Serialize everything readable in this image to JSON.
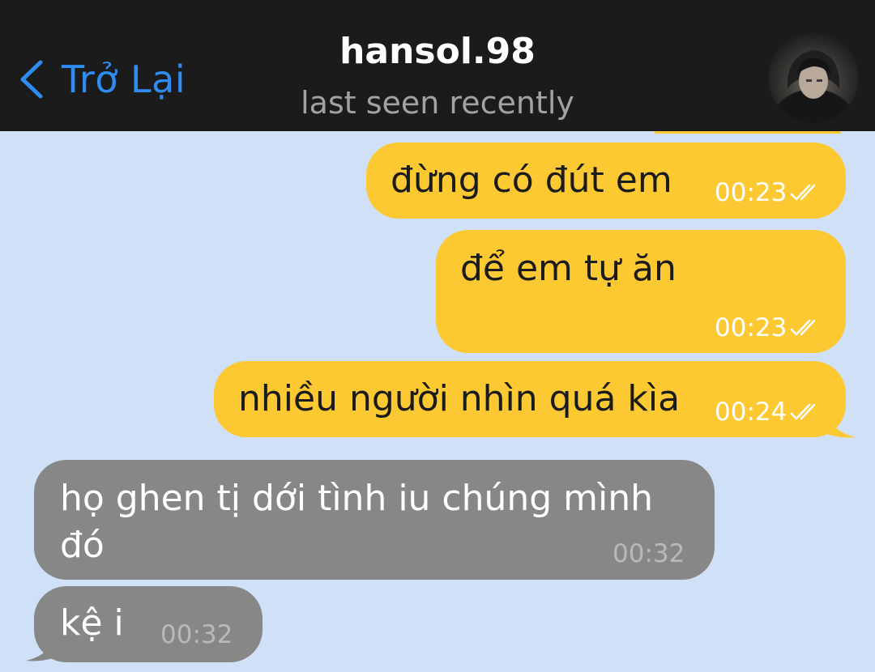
{
  "header": {
    "back_label": "Trở Lại",
    "title": "hansol.98",
    "status": "last seen recently"
  },
  "colors": {
    "header_bg": "#1b1b1b",
    "accent": "#2f8cf0",
    "chat_bg": "#cfe0f7",
    "outgoing_bubble": "#fdc932",
    "incoming_bubble": "#878787"
  },
  "messages": [
    {
      "direction": "outgoing",
      "text": "đừng có đút em",
      "time": "00:23",
      "read_status": "double-check-icon"
    },
    {
      "direction": "outgoing",
      "text": "để em tự ăn",
      "time": "00:23",
      "read_status": "double-check-icon"
    },
    {
      "direction": "outgoing",
      "text": "nhiều người nhìn quá kìa",
      "time": "00:24",
      "read_status": "double-check-icon"
    },
    {
      "direction": "incoming",
      "text_line1": "họ ghen tị dới tình iu chúng mình",
      "text_line2": "đó",
      "time": "00:32"
    },
    {
      "direction": "incoming",
      "text": "kệ i",
      "time": "00:32"
    }
  ]
}
